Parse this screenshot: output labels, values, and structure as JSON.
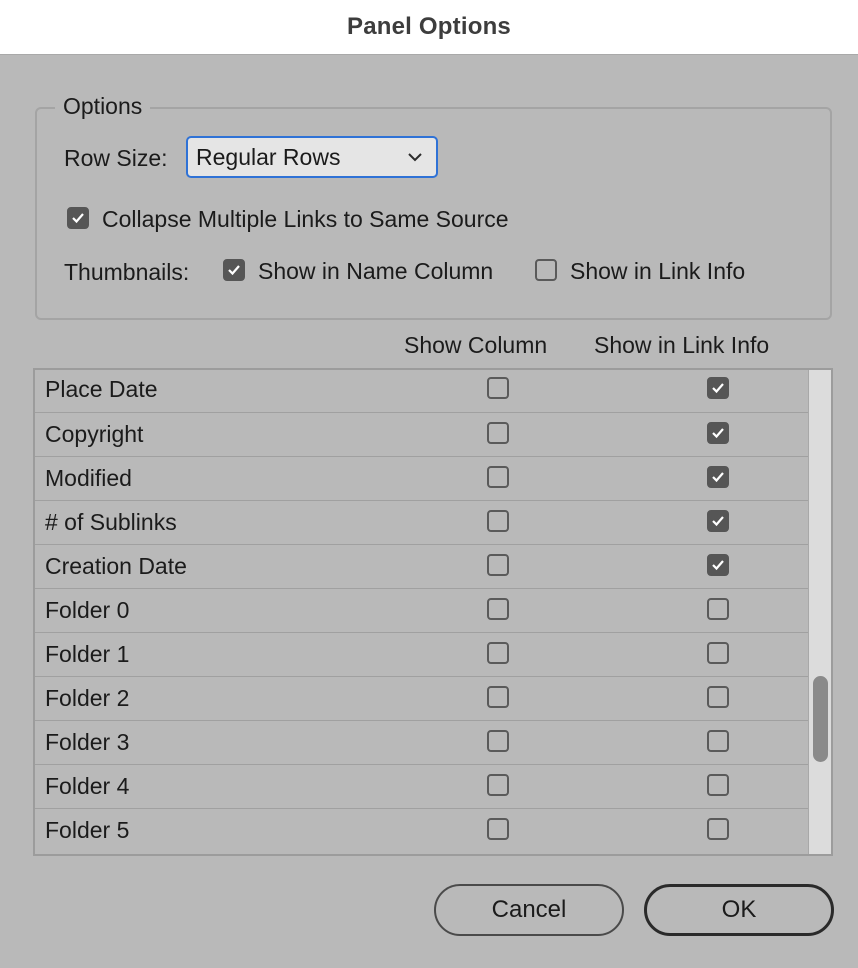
{
  "dialog": {
    "title": "Panel Options"
  },
  "options": {
    "legend": "Options",
    "row_size_label": "Row Size:",
    "row_size_value": "Regular Rows",
    "collapse_label": "Collapse Multiple Links to Same Source",
    "collapse_checked": true,
    "thumbnails_label": "Thumbnails:",
    "thumb_name_label": "Show in Name Column",
    "thumb_name_checked": true,
    "thumb_info_label": "Show in Link Info",
    "thumb_info_checked": false
  },
  "table": {
    "headers": {
      "show_column": "Show Column",
      "show_in_link_info": "Show in Link Info"
    },
    "rows": [
      {
        "name": "Place Date",
        "show_column": false,
        "show_link_info": true
      },
      {
        "name": "Copyright",
        "show_column": false,
        "show_link_info": true
      },
      {
        "name": "Modified",
        "show_column": false,
        "show_link_info": true
      },
      {
        "name": "# of Sublinks",
        "show_column": false,
        "show_link_info": true
      },
      {
        "name": "Creation Date",
        "show_column": false,
        "show_link_info": true
      },
      {
        "name": "Folder 0",
        "show_column": false,
        "show_link_info": false
      },
      {
        "name": "Folder 1",
        "show_column": false,
        "show_link_info": false
      },
      {
        "name": "Folder 2",
        "show_column": false,
        "show_link_info": false
      },
      {
        "name": "Folder 3",
        "show_column": false,
        "show_link_info": false
      },
      {
        "name": "Folder 4",
        "show_column": false,
        "show_link_info": false
      },
      {
        "name": "Folder 5",
        "show_column": false,
        "show_link_info": false
      }
    ]
  },
  "buttons": {
    "cancel": "Cancel",
    "ok": "OK"
  },
  "colors": {
    "background": "#b9b9b9",
    "focus_ring": "#2f72d6",
    "checked_fill": "#565656"
  }
}
